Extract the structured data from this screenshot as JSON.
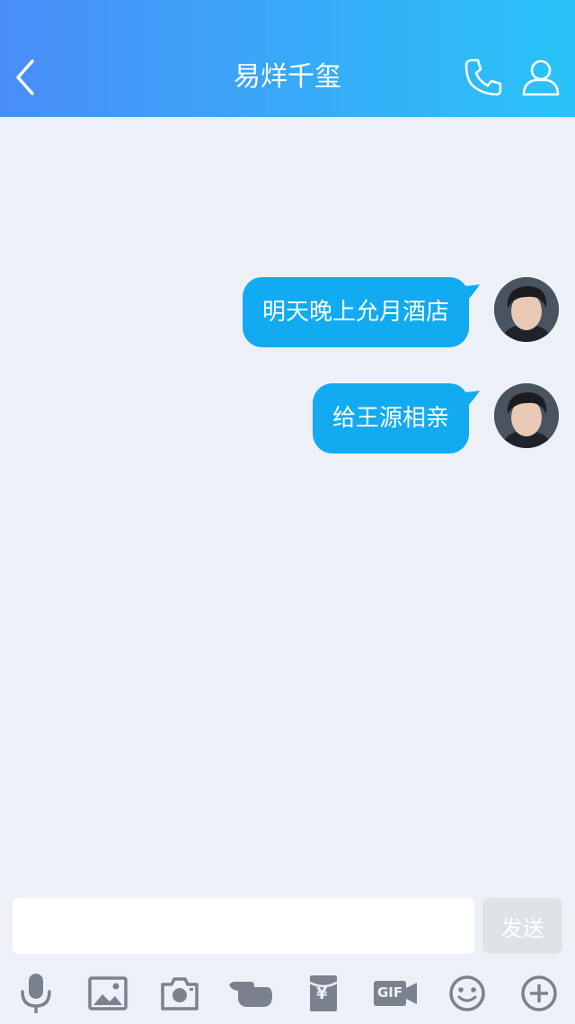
{
  "header": {
    "title": "易烊千玺"
  },
  "messages": [
    {
      "text": "明天晚上允月酒店",
      "sender": "me"
    },
    {
      "text": "给王源相亲",
      "sender": "me"
    }
  ],
  "composer": {
    "input_value": "",
    "send_label": "发送"
  },
  "toolbar": {
    "icons": [
      "microphone-icon",
      "image-icon",
      "camera-icon",
      "poke-hand-icon",
      "red-packet-icon",
      "gif-icon",
      "emoji-icon",
      "plus-icon"
    ],
    "gif_text": "GIF",
    "yen_text": "¥"
  },
  "colors": {
    "header_start": "#4a8df8",
    "header_end": "#29c3f9",
    "bubble": "#12aaf0",
    "background": "#edf1f7",
    "icon_gray": "#7a8290"
  }
}
